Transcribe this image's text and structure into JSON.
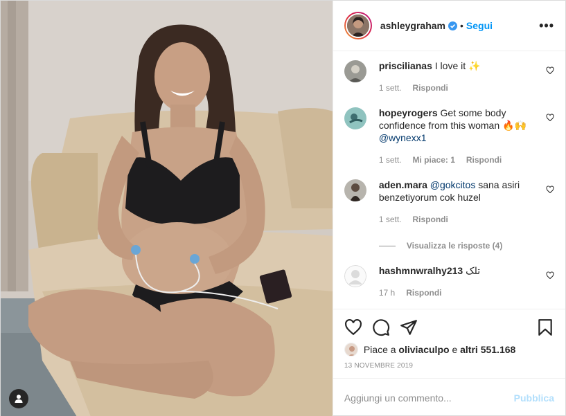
{
  "post": {
    "author": "ashleygraham",
    "follow_label": "Segui",
    "separator": "•",
    "more_label": "•••"
  },
  "comments": [
    {
      "user": "priscilianas",
      "text": "I love it ✨",
      "time": "1 sett.",
      "likes": "",
      "reply": "Rispondi"
    },
    {
      "user": "hopeyrogers",
      "text": "Get some body confidence from this woman 🔥🙌",
      "mention": "@wynexx1",
      "time": "1 sett.",
      "likes": "Mi piace: 1",
      "reply": "Rispondi"
    },
    {
      "user": "aden.mara",
      "mention": "@gokcitos",
      "text": "sana asiri benzetiyorum cok huzel",
      "time": "1 sett.",
      "likes": "",
      "reply": "Rispondi"
    },
    {
      "user": "hashmnwralhy213",
      "text": "تلک",
      "time": "17 h",
      "likes": "",
      "reply": "Rispondi"
    }
  ],
  "view_replies_label": "Visualizza le risposte (4)",
  "likes": {
    "prefix": "Piace a",
    "user": "oliviaculpo",
    "conj": "e",
    "others": "altri 551.168"
  },
  "date": "13 NOVEMBRE 2019",
  "add_comment": {
    "placeholder": "Aggiungi un commento...",
    "publish_label": "Pubblica"
  },
  "icons": [
    "heart-icon",
    "comment-icon",
    "share-icon",
    "bookmark-icon",
    "verified-icon",
    "user-tag-icon",
    "more-icon"
  ],
  "colors": {
    "accent": "#0095f6",
    "publish_disabled": "#b2dffc",
    "text": "#262626",
    "muted": "#8e8e8e"
  }
}
